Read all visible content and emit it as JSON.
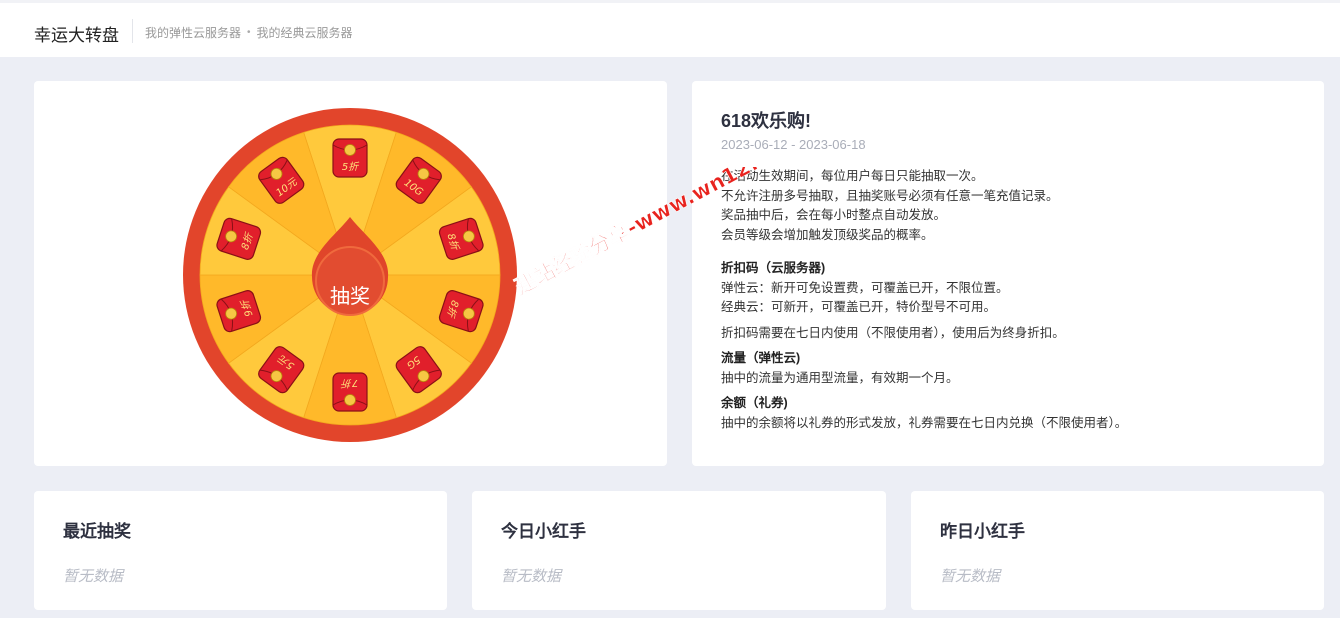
{
  "header": {
    "title": "幸运大转盘",
    "breadcrumbs": [
      "我的弹性云服务器",
      "我的经典云服务器"
    ],
    "separator": "•"
  },
  "wheel": {
    "button_label": "抽奖",
    "prizes": [
      "5折",
      "10G",
      "8折",
      "8折",
      "5G",
      "7折",
      "5元",
      "9折",
      "8折",
      "10元"
    ],
    "colors": {
      "rim": "#e2452b",
      "segment_light": "#ffc93c",
      "segment_dark": "#ffb92a",
      "center": "#e0452a",
      "envelope": "#e11f2b",
      "coin": "#f6c744"
    }
  },
  "event": {
    "title": "618欢乐购!",
    "date_range": "2023-06-12 - 2023-06-18",
    "rules": [
      "在活动生效期间，每位用户每日只能抽取一次。",
      "不允许注册多号抽取，且抽奖账号必须有任意一笔充值记录。",
      "奖品抽中后，会在每小时整点自动发放。",
      "会员等级会增加触发顶级奖品的概率。"
    ],
    "sections": [
      {
        "title": "折扣码（云服务器)",
        "lines": [
          "弹性云：新开可免设置费，可覆盖已开，不限位置。",
          "经典云：可新开，可覆盖已开，特价型号不可用。"
        ],
        "extra": "折扣码需要在七日内使用（不限使用者），使用后为终身折扣。"
      },
      {
        "title": "流量（弹性云)",
        "lines": [
          "抽中的流量为通用型流量，有效期一个月。"
        ]
      },
      {
        "title": "余额（礼券)",
        "lines": [
          "抽中的余额将以礼券的形式发放，礼券需要在七日内兑换（不限使用者）。"
        ]
      }
    ]
  },
  "watermark": {
    "text": "建站经验分享-www.wn12.cn",
    "color": "#e8231e"
  },
  "panels": [
    {
      "title": "最近抽奖",
      "empty": "暂无数据"
    },
    {
      "title": "今日小红手",
      "empty": "暂无数据"
    },
    {
      "title": "昨日小红手",
      "empty": "暂无数据"
    }
  ]
}
